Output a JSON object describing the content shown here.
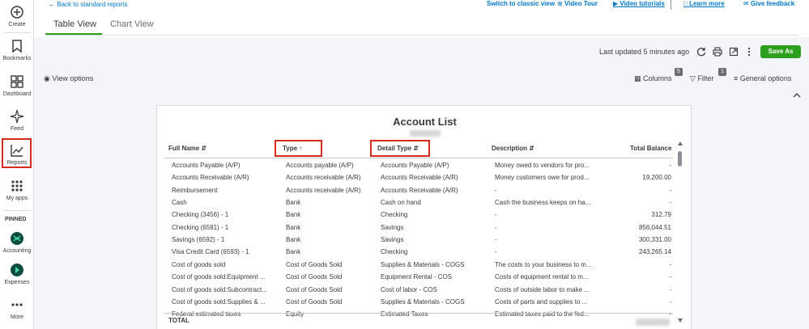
{
  "sidebar": {
    "items": [
      {
        "label": "Create",
        "icon": "plus-circle-icon"
      },
      {
        "label": "Bookmarks",
        "icon": "bookmark-icon"
      },
      {
        "label": "Dashboard",
        "icon": "dashboard-grid-icon"
      },
      {
        "label": "Feed",
        "icon": "sparkle-icon"
      },
      {
        "label": "Reports",
        "icon": "line-chart-icon"
      },
      {
        "label": "My apps",
        "icon": "apps-grid-icon"
      }
    ],
    "pinned_label": "PINNED",
    "pinned": [
      {
        "label": "Accounting",
        "icon": "accounting-icon",
        "color": "#0d7c66"
      },
      {
        "label": "Expenses",
        "icon": "expenses-icon",
        "color": "#0d7c66"
      }
    ],
    "more_label": "More",
    "highlight_color": "#d52b1e"
  },
  "header": {
    "back_link": "Back to standard reports",
    "switch_classic": "Switch to classic view",
    "video_tour": "Video Tour",
    "video_tutorials": "Video tutorials",
    "learn_more": "Learn more",
    "give_feedback": "Give feedback",
    "tabs": [
      {
        "label": "Table View",
        "active": true
      },
      {
        "label": "Chart View",
        "active": false
      }
    ]
  },
  "toolbar": {
    "last_updated": "Last updated 5 minutes ago",
    "save_as": "Save As",
    "accent": "#2ca01c"
  },
  "options": {
    "view_options": "View options",
    "columns": "Columns",
    "columns_badge": "5",
    "filter": "Filter",
    "filter_badge": "1",
    "general_options": "General options"
  },
  "report": {
    "title": "Account List",
    "columns": {
      "full_name": "Full Name",
      "type": "Type",
      "detail_type": "Detail Type",
      "description": "Description",
      "total_balance": "Total Balance"
    },
    "rows": [
      [
        "Accounts Payable (A/P)",
        "Accounts payable (A/P)",
        "Accounts Payable (A/P)",
        "Money owed to vendors for pro...",
        "-"
      ],
      [
        "Accounts Receivable (A/R)",
        "Accounts receivable (A/R)",
        "Accounts Receivable (A/R)",
        "Money customers owe for prod...",
        "19,200.00"
      ],
      [
        "Reimbursement",
        "Accounts receivable (A/R)",
        "Accounts Receivable (A/R)",
        "-",
        "-"
      ],
      [
        "Cash",
        "Bank",
        "Cash on hand",
        "Cash the business keeps on ha...",
        "-"
      ],
      [
        "Checking (3456) - 1",
        "Bank",
        "Checking",
        "-",
        "312.79"
      ],
      [
        "Checking (6591) - 1",
        "Bank",
        "Savings",
        "-",
        "856,044.51"
      ],
      [
        "Savings (6592) - 1",
        "Bank",
        "Savings",
        "-",
        "300,331.00"
      ],
      [
        "Visa Credit Card (6593) - 1",
        "Bank",
        "Checking",
        "-",
        "243,265.14"
      ],
      [
        "Cost of goods sold",
        "Cost of Goods Sold",
        "Supplies & Materials - COGS",
        "The costs to your business to m...",
        "-"
      ],
      [
        "Cost of goods sold:Equipment ...",
        "Cost of Goods Sold",
        "Equipment Rental - COS",
        "Costs of equipment rental to m...",
        "-"
      ],
      [
        "Cost of goods sold:Subcontract...",
        "Cost of Goods Sold",
        "Cost of labor - COS",
        "Costs of outside labor to make ...",
        "-"
      ],
      [
        "Cost of goods sold:Supplies & ...",
        "Cost of Goods Sold",
        "Supplies & Materials - COGS",
        "Costs of parts and supplies to ...",
        "-"
      ],
      [
        "Federal estimated taxes",
        "Equity",
        "Estimated Taxes",
        "Estimated taxes paid to the fed...",
        "-"
      ]
    ],
    "total_label": "TOTAL"
  }
}
